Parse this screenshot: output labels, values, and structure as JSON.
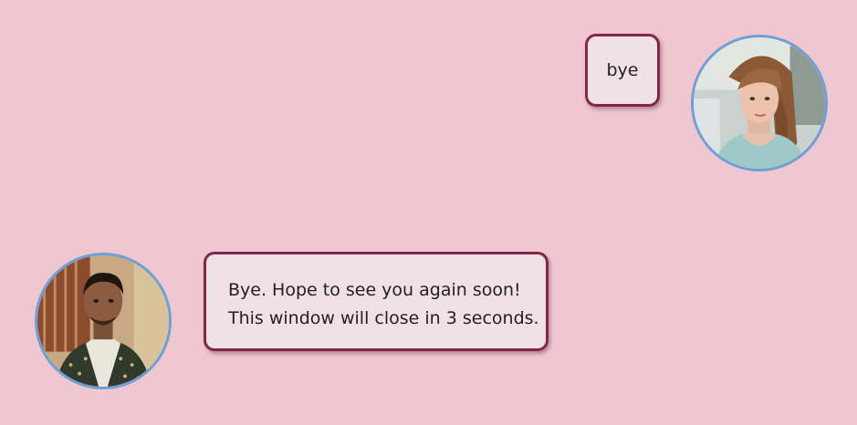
{
  "conversation": {
    "user_message": {
      "text": "bye",
      "avatar_icon": "woman-portrait-avatar"
    },
    "bot_message": {
      "line1": "Bye. Hope to see you again soon!",
      "line2": "This window will close in 3 seconds.",
      "avatar_icon": "man-portrait-avatar"
    }
  },
  "colors": {
    "background": "#efc7d1",
    "bubble_fill": "#efe1e5",
    "bubble_border": "#84254a",
    "avatar_border": "#6f9fd6"
  }
}
